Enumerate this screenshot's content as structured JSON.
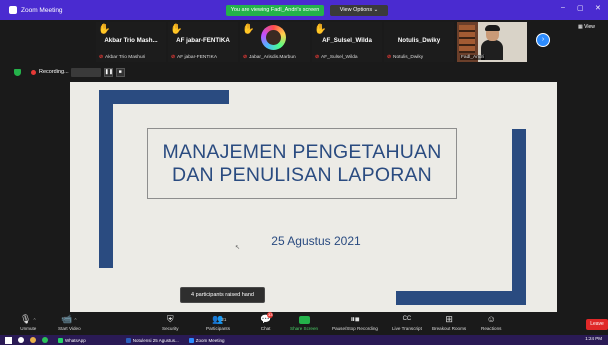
{
  "titlebar": {
    "app_title": "Zoom Meeting",
    "viewing_banner": "You are viewing Fadl_Andri's screen",
    "view_options": "View Options",
    "minimize": "–",
    "maximize": "▢",
    "close": "✕",
    "side_view": "View"
  },
  "participants": [
    {
      "name": "Akbar Trio Mash...",
      "label": "Akbar Trio Mashuri",
      "raised_hand": true
    },
    {
      "name": "AF jabar-FENTIKA",
      "label": "AF jabar-FENTIKA",
      "raised_hand": true
    },
    {
      "name": "",
      "label": "Jabar_Arisdis.Marbun",
      "raised_hand": true
    },
    {
      "name": "AF_Sulsel_Wilda",
      "label": "AF_Sulsel_Wilda",
      "raised_hand": true
    },
    {
      "name": "Notulis_Dwiky",
      "label": "Notulis_Dwiky",
      "raised_hand": false
    },
    {
      "name": "",
      "label": "Fadl_Andri",
      "raised_hand": false
    }
  ],
  "recording": {
    "label": "Recording..."
  },
  "slide": {
    "title_line1": "MANAJEMEN PENGETAHUAN",
    "title_line2": "DAN PENULISAN LAPORAN",
    "date": "25 Agustus 2021"
  },
  "toast": "4 participants raised hand",
  "toolbar": {
    "unmute": "Unmute",
    "start_video": "Start Video",
    "security": "Security",
    "participants": "Participants",
    "participants_count": "21",
    "chat": "Chat",
    "chat_badge": "33",
    "share_screen": "Share Screen",
    "pause_recording": "Pause/Stop Recording",
    "live_transcript": "Live Transcript",
    "cc": "CC",
    "breakout_rooms": "Breakout Rooms",
    "reactions": "Reactions",
    "leave": "Leave"
  },
  "taskbar": {
    "apps": [
      "WhatsApp",
      "Notulensi 25 Agustus...",
      "Zoom Meeting"
    ],
    "time": "1:24 PM"
  },
  "colors": {
    "zoom_purple": "#4a2bd0",
    "share_green": "#24b24a",
    "slide_blue": "#2a4b80",
    "leave_red": "#e02828"
  }
}
